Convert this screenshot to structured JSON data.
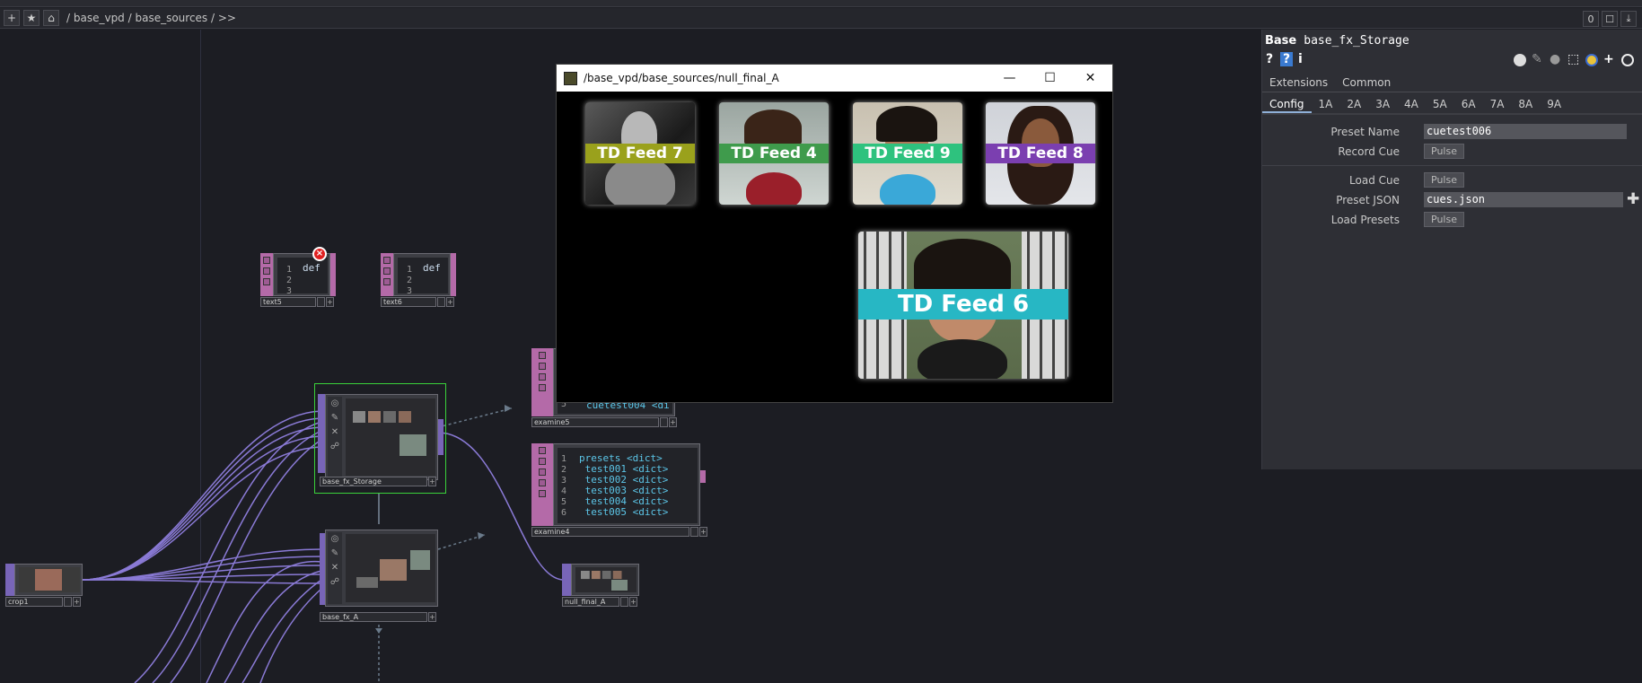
{
  "pathbar": {
    "path": "/ base_vpd / base_sources / >>",
    "plus_icon": "+",
    "star_icon": "★",
    "home_icon": "⌂",
    "right_zero": "0"
  },
  "nodes": {
    "text5": {
      "label": "text5",
      "code": "def",
      "lines": [
        "1",
        "2",
        "3"
      ]
    },
    "text6": {
      "label": "text6",
      "code": "def",
      "lines": [
        "1",
        "2",
        "3"
      ]
    },
    "examine5": {
      "label": "examine5",
      "line_num": "5",
      "line_text": "cuetest004 <di"
    },
    "examine4": {
      "label": "examine4",
      "rows": [
        {
          "n": "1",
          "text": "presets <dict>"
        },
        {
          "n": "2",
          "text": " test001 <dict>"
        },
        {
          "n": "3",
          "text": " test002 <dict>"
        },
        {
          "n": "4",
          "text": " test003 <dict>"
        },
        {
          "n": "5",
          "text": " test004 <dict>"
        },
        {
          "n": "6",
          "text": " test005 <dict>"
        }
      ]
    },
    "base_fx_storage": {
      "label": "base_fx_Storage"
    },
    "base_fx_a": {
      "label": "base_fx_A"
    },
    "crop1": {
      "label": "crop1"
    },
    "null_final_a": {
      "label": "null_final_A"
    }
  },
  "preview": {
    "path": "/base_vpd/base_sources/null_final_A",
    "minimize": "—",
    "maximize": "☐",
    "close": "✕",
    "feeds": [
      {
        "label": "TD Feed 7",
        "color": "#9aa11c"
      },
      {
        "label": "TD Feed 4",
        "color": "#3f9b4c"
      },
      {
        "label": "TD Feed 9",
        "color": "#2ec27e"
      },
      {
        "label": "TD Feed 8",
        "color": "#7b3fb0"
      },
      {
        "label": "TD Feed 6",
        "color": "#27b7c4"
      }
    ]
  },
  "params": {
    "op_type": "Base",
    "op_name": "base_fx_Storage",
    "top_tabs": [
      "Extensions",
      "Common"
    ],
    "page_tabs": [
      "Config",
      "1A",
      "2A",
      "3A",
      "4A",
      "5A",
      "6A",
      "7A",
      "8A",
      "9A"
    ],
    "rows": {
      "preset_name": {
        "label": "Preset Name",
        "value": "cuetest006"
      },
      "record_cue": {
        "label": "Record Cue",
        "button": "Pulse"
      },
      "load_cue": {
        "label": "Load Cue",
        "button": "Pulse"
      },
      "preset_json": {
        "label": "Preset JSON",
        "value": "cues.json"
      },
      "load_presets": {
        "label": "Load Presets",
        "button": "Pulse"
      }
    }
  }
}
